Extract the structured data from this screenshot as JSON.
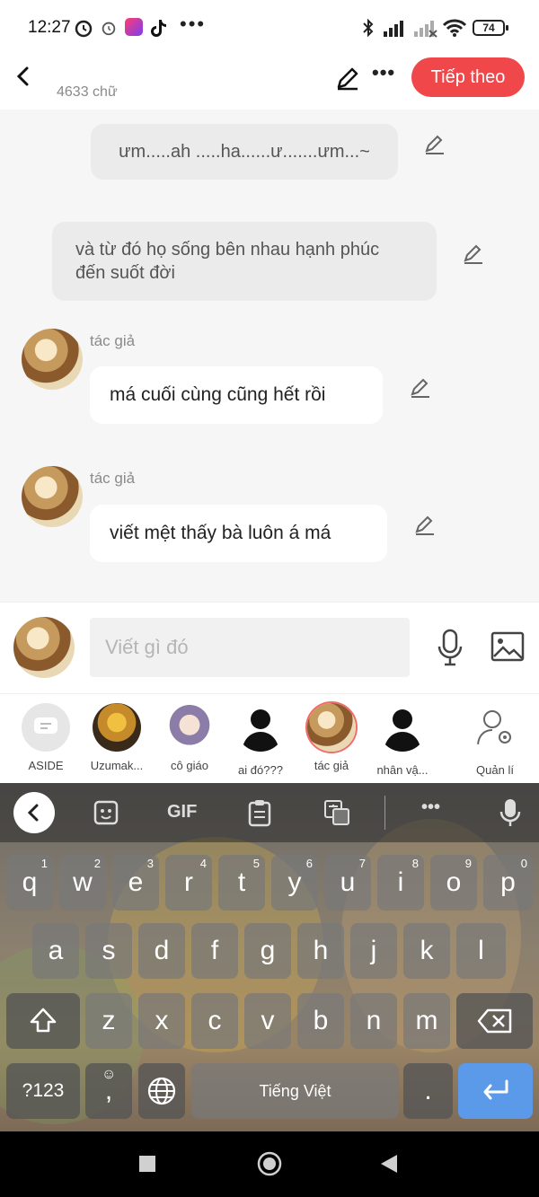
{
  "status_bar": {
    "time": "12:27",
    "battery": "74",
    "dots": "•••"
  },
  "header": {
    "word_count": "4633 chữ",
    "next_button": "Tiếp theo"
  },
  "messages": [
    {
      "kind": "narration",
      "text": "ưm.....ah .....ha......ư.......ưm...~"
    },
    {
      "kind": "narration",
      "text": "và từ đó họ sống bên nhau hạnh phúc đến suốt đời"
    },
    {
      "kind": "speech",
      "speaker": "tác giả",
      "text": "má cuối cùng cũng hết rồi"
    },
    {
      "kind": "speech",
      "speaker": "tác giả",
      "text": "viết mệt thấy bà luôn á má"
    }
  ],
  "input": {
    "placeholder": "Viết gì đó"
  },
  "characters": [
    {
      "name": "ASIDE"
    },
    {
      "name": "Uzumak..."
    },
    {
      "name": "cô giáo"
    },
    {
      "name": "ai đó???"
    },
    {
      "name": "tác giả"
    },
    {
      "name": "nhân vậ..."
    },
    {
      "name": "Quản lí"
    }
  ],
  "keyboard": {
    "toolbar": {
      "gif": "GIF",
      "more": "•••"
    },
    "row1": [
      "q",
      "w",
      "e",
      "r",
      "t",
      "y",
      "u",
      "i",
      "o",
      "p"
    ],
    "row1_nums": [
      "1",
      "2",
      "3",
      "4",
      "5",
      "6",
      "7",
      "8",
      "9",
      "0"
    ],
    "row2": [
      "a",
      "s",
      "d",
      "f",
      "g",
      "h",
      "j",
      "k",
      "l"
    ],
    "row3": [
      "z",
      "x",
      "c",
      "v",
      "b",
      "n",
      "m"
    ],
    "symbols": "?123",
    "comma": ",",
    "space": "Tiếng Việt",
    "period": "."
  }
}
